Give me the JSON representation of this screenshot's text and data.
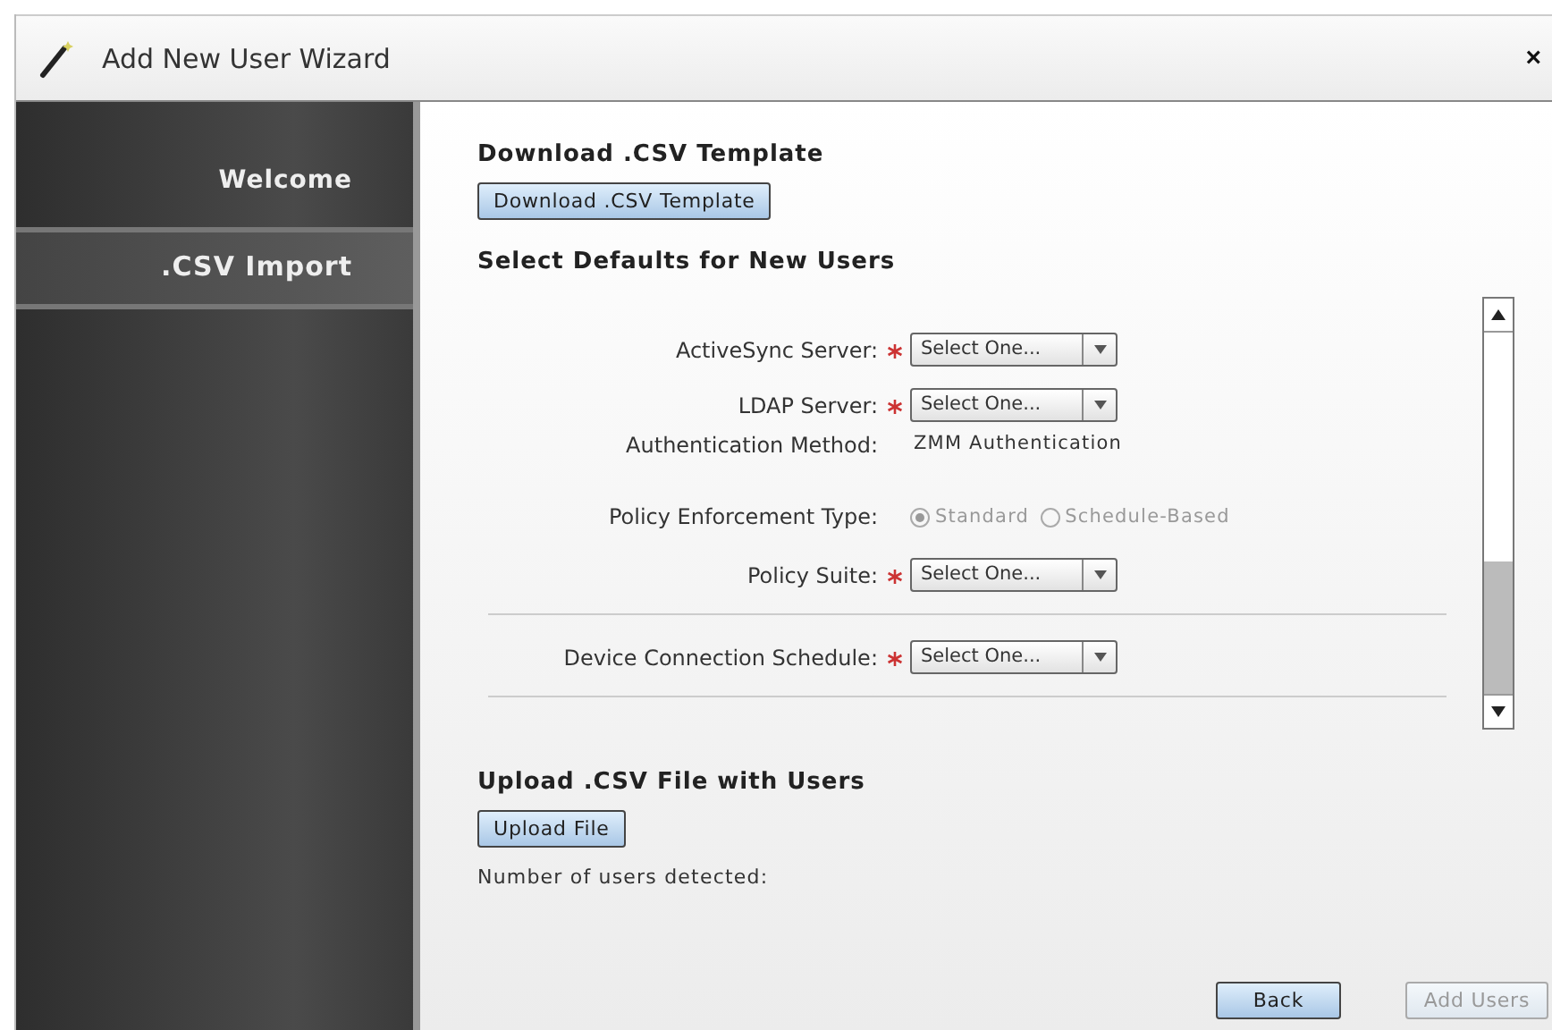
{
  "window": {
    "title": "Add New User Wizard",
    "close": "×"
  },
  "sidebar": {
    "items": [
      {
        "label": "Welcome",
        "selected": false
      },
      {
        "label": ".CSV Import",
        "selected": true
      }
    ]
  },
  "download": {
    "heading": "Download .CSV Template",
    "button": "Download .CSV Template"
  },
  "defaults": {
    "heading": "Select Defaults for New Users",
    "fields": [
      {
        "kind": "select",
        "label": "ActiveSync Server:",
        "required": true,
        "value": "Select One..."
      },
      {
        "kind": "select",
        "label": "LDAP Server:",
        "required": true,
        "value": "Select One..."
      },
      {
        "kind": "text",
        "label": "Authentication Method:",
        "value": "ZMM Authentication"
      },
      {
        "kind": "radio",
        "label": "Policy Enforcement Type:",
        "disabled": true,
        "options": [
          {
            "label": "Standard",
            "selected": true
          },
          {
            "label": "Schedule-Based",
            "selected": false
          }
        ]
      },
      {
        "kind": "select",
        "label": "Policy Suite:",
        "required": true,
        "value": "Select One..."
      },
      {
        "kind": "divider"
      },
      {
        "kind": "select",
        "label": "Device Connection Schedule:",
        "required": true,
        "value": "Select One..."
      },
      {
        "kind": "divider"
      }
    ]
  },
  "upload": {
    "heading": "Upload .CSV File with Users",
    "button": "Upload File",
    "count_label": "Number of users detected:"
  },
  "buttons": [
    {
      "label": "Back",
      "disabled": false
    },
    {
      "label": "Add Users",
      "disabled": true
    }
  ]
}
